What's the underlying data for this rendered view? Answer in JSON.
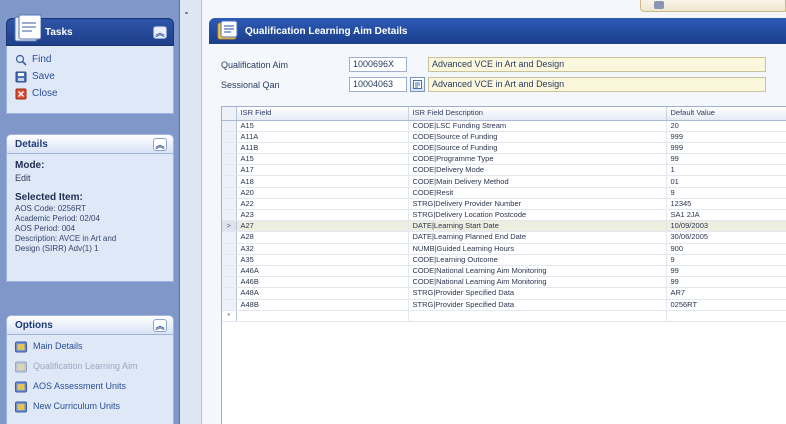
{
  "sidebar": {
    "tasks": {
      "title": "Tasks",
      "items": [
        {
          "label": "Find",
          "icon": "find-icon"
        },
        {
          "label": "Save",
          "icon": "save-icon"
        },
        {
          "label": "Close",
          "icon": "close-icon"
        }
      ]
    },
    "details": {
      "title": "Details",
      "mode_label": "Mode:",
      "mode_value": "Edit",
      "selected_label": "Selected Item:",
      "selected_lines": [
        "AOS Code: 0256RT",
        "Academic Period: 02/04",
        "AOS Period: 004",
        "Description: AVCE in Art and",
        "Design (SIRR) Adv(1) 1"
      ]
    },
    "options": {
      "title": "Options",
      "items": [
        {
          "label": "Main Details",
          "icon": "details-icon",
          "enabled": true
        },
        {
          "label": "Qualification Learning Aim",
          "icon": "qualification-icon",
          "enabled": false
        },
        {
          "label": "AOS Assessment Units",
          "icon": "assessment-icon",
          "enabled": true
        },
        {
          "label": "New Curriculum Units",
          "icon": "curriculum-icon",
          "enabled": true
        }
      ]
    }
  },
  "main": {
    "top_button_label": "",
    "title": "Qualification Learning Aim Details",
    "fields": {
      "qualification_aim": {
        "label": "Qualification Aim",
        "value": "1000696X",
        "description": "Advanced VCE in Art and Design"
      },
      "sessional_qan": {
        "label": "Sessional Qan",
        "value": "10004063",
        "description": "Advanced VCE in Art and Design"
      }
    },
    "grid": {
      "columns": [
        "ISR Field",
        "ISR Field Description",
        "Default Value"
      ],
      "rows": [
        [
          "A15",
          "CODE|LSC Funding Stream",
          "20"
        ],
        [
          "A11A",
          "CODE|Source of Funding",
          "999"
        ],
        [
          "A11B",
          "CODE|Source of Funding",
          "999"
        ],
        [
          "A15",
          "CODE|Programme Type",
          "99"
        ],
        [
          "A17",
          "CODE|Delivery Mode",
          "1"
        ],
        [
          "A18",
          "CODE|Main Delivery Method",
          "01"
        ],
        [
          "A20",
          "CODE|Resit",
          "9"
        ],
        [
          "A22",
          "STRG|Delivery Provider Number",
          "12345"
        ],
        [
          "A23",
          "STRG|Delivery Location Postcode",
          "SA1 2JA"
        ],
        [
          "A27",
          "DATE|Learning Start Date",
          "10/09/2003"
        ],
        [
          "A28",
          "DATE|Learning Planned End Date",
          "30/06/2005"
        ],
        [
          "A32",
          "NUMB|Guided Learning Hours",
          "900"
        ],
        [
          "A35",
          "CODE|Learning Outcome",
          "9"
        ],
        [
          "A46A",
          "CODE|National Learning Aim Monitoring",
          "99"
        ],
        [
          "A46B",
          "CODE|National Learning Aim Monitoring",
          "99"
        ],
        [
          "A48A",
          "STRG|Provider Specified Data",
          "AR7"
        ],
        [
          "A48B",
          "STRG|Provider Specified Data",
          "0256RT"
        ]
      ],
      "selected_row_index": 9,
      "selected_marker": ">",
      "new_row_marker": "*"
    }
  },
  "colors": {
    "title_bar": "#1f4494",
    "sidebar_bg": "#7f97c9",
    "panel_bg": "#dfe8f6",
    "selected_row": "#eeeee0",
    "description_field": "#fbf7dc"
  }
}
